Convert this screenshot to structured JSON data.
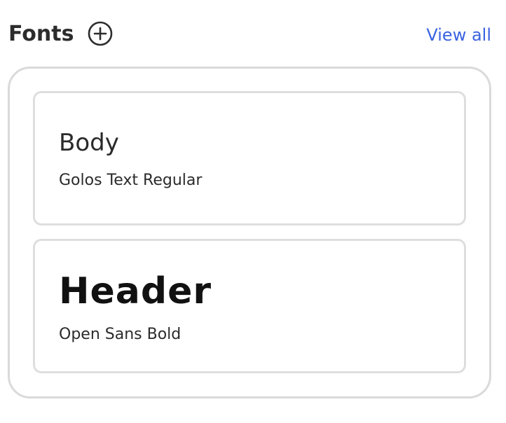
{
  "section": {
    "title": "Fonts",
    "add_icon": "plus-circle-icon",
    "view_all_label": "View all",
    "link_color": "#3b63e0"
  },
  "fonts": [
    {
      "role": "Body",
      "name": "Golos Text Regular"
    },
    {
      "role": "Header",
      "name": "Open Sans Bold"
    }
  ]
}
